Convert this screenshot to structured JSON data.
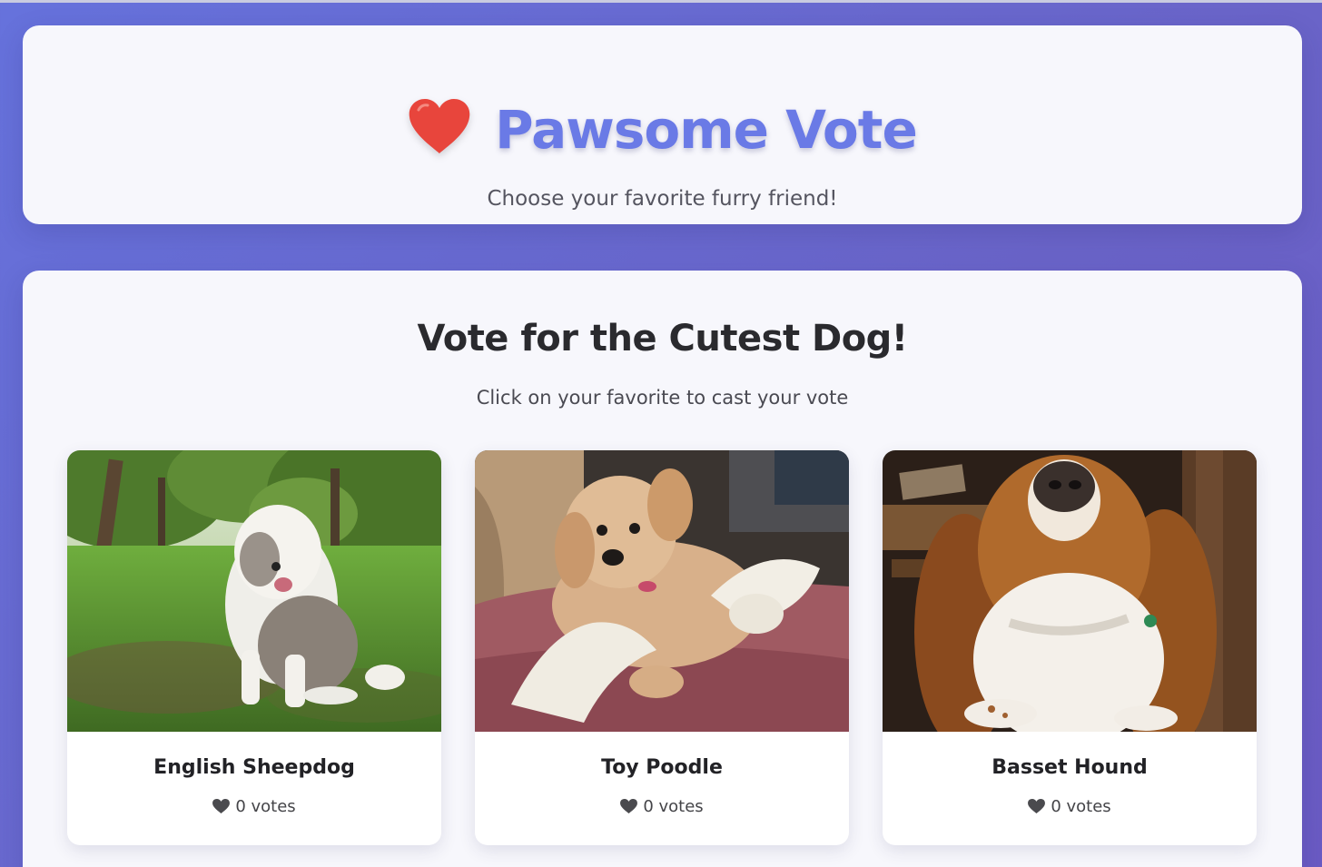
{
  "header": {
    "title": "Pawsome Vote",
    "subtitle": "Choose your favorite furry friend!",
    "title_color": "#6a7ae6",
    "heart_color": "#e8453c"
  },
  "main": {
    "title": "Vote for the Cutest Dog!",
    "subtitle": "Click on your favorite to cast your vote",
    "dogs": [
      {
        "name": "English Sheepdog",
        "votes": "0 votes",
        "icon": "heart-icon"
      },
      {
        "name": "Toy Poodle",
        "votes": "0 votes",
        "icon": "heart-icon"
      },
      {
        "name": "Basset Hound",
        "votes": "0 votes",
        "icon": "heart-icon"
      }
    ]
  }
}
